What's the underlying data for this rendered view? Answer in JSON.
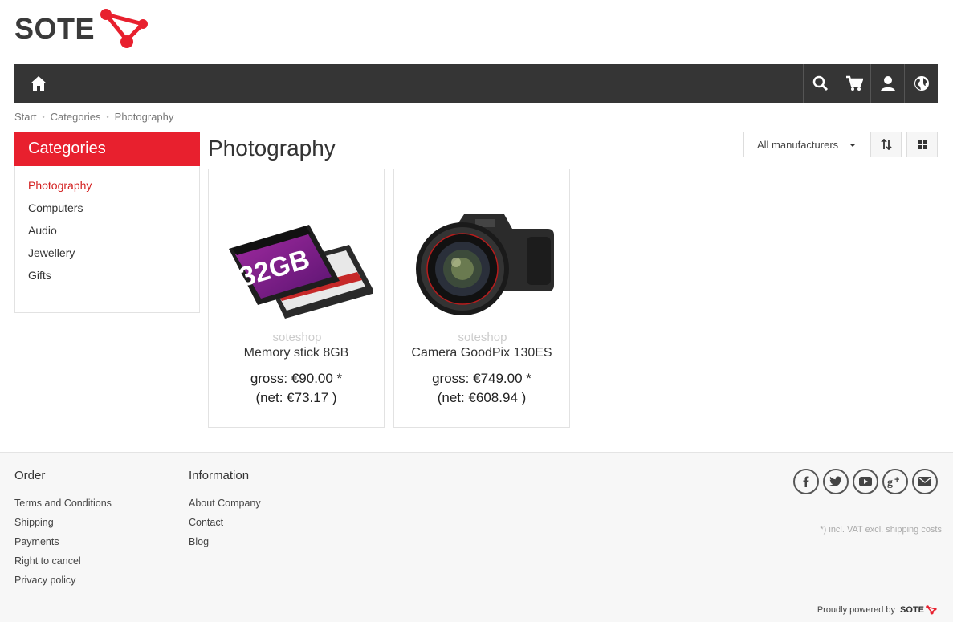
{
  "brand": {
    "name": "SOTE",
    "accent": "#e8202e"
  },
  "nav": {
    "home_icon": "home-icon",
    "right_icons": [
      "search-icon",
      "cart-icon",
      "user-icon",
      "globe-icon"
    ]
  },
  "breadcrumb": [
    "Start",
    "Categories",
    "Photography"
  ],
  "sidebar": {
    "title": "Categories",
    "items": [
      {
        "label": "Photography",
        "active": true
      },
      {
        "label": "Computers"
      },
      {
        "label": "Audio"
      },
      {
        "label": "Jewellery"
      },
      {
        "label": "Gifts"
      }
    ]
  },
  "main": {
    "title": "Photography",
    "manufacturer_select": "All manufacturers",
    "products": [
      {
        "name": "Memory stick 8GB",
        "gross": "gross: €90.00 *",
        "net": "(net: €73.17 )",
        "watermark": "soteshop",
        "card_label": "32GB"
      },
      {
        "name": "Camera GoodPix 130ES",
        "gross": "gross: €749.00 *",
        "net": "(net: €608.94 )",
        "watermark": "soteshop"
      }
    ]
  },
  "footer": {
    "order": {
      "title": "Order",
      "links": [
        "Terms and Conditions",
        "Shipping",
        "Payments",
        "Right to cancel",
        "Privacy policy"
      ]
    },
    "information": {
      "title": "Information",
      "links": [
        "About Company",
        "Contact",
        "Blog"
      ]
    },
    "social_icons": [
      "facebook-icon",
      "twitter-icon",
      "youtube-icon",
      "google-plus-icon",
      "email-icon"
    ],
    "vat_note": "*) incl. VAT excl. shipping costs",
    "powered_by": "Proudly powered by",
    "powered_brand": "SOTE"
  }
}
